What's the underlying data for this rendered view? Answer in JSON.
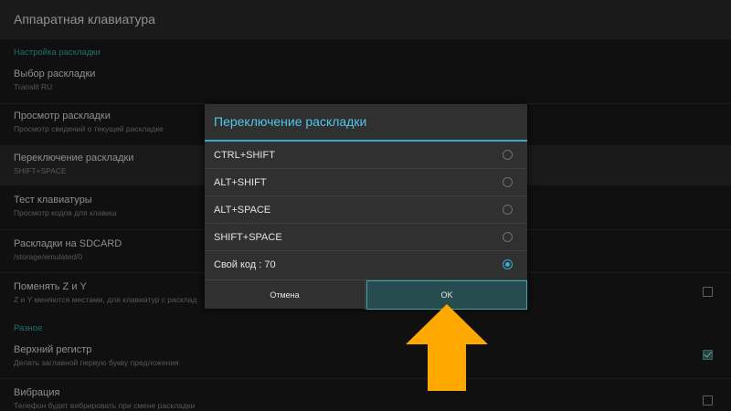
{
  "app": {
    "title": "Аппаратная клавиатура"
  },
  "sections": {
    "layout_settings": "Настройка раскладки",
    "misc": "Разное"
  },
  "prefs": [
    {
      "title": "Выбор раскладки",
      "summary": "Translit RU"
    },
    {
      "title": "Просмотр раскладки",
      "summary": "Просмотр сведений о текущей раскладке"
    },
    {
      "title": "Переключение раскладки",
      "summary": "SHIFT+SPACE"
    },
    {
      "title": "Тест клавиатуры",
      "summary": "Просмотр кодов для клавиш"
    },
    {
      "title": "Раскладки на SDCARD",
      "summary": "/storage/emulated/0"
    },
    {
      "title": "Поменять Z и Y",
      "summary": "Z и Y меняются местами, для клавиатур с расклад",
      "checked": false
    },
    {
      "title": "Верхний регистр",
      "summary": "Делать заглавной первую букву предложения",
      "checked": true
    },
    {
      "title": "Вибрация",
      "summary": "Телефон будет вибрировать при смене раскладки",
      "checked": false
    }
  ],
  "dialog": {
    "title": "Переключение раскладки",
    "options": [
      {
        "label": "CTRL+SHIFT",
        "selected": false
      },
      {
        "label": "ALT+SHIFT",
        "selected": false
      },
      {
        "label": "ALT+SPACE",
        "selected": false
      },
      {
        "label": "SHIFT+SPACE",
        "selected": false
      },
      {
        "label": "Свой код : 70",
        "selected": true
      }
    ],
    "cancel_label": "Отмена",
    "ok_label": "OK"
  },
  "colors": {
    "accent": "#38a9cf",
    "section": "#31b6a5",
    "arrow": "#ffa800"
  },
  "icons": {
    "annotation": "arrow-up-icon"
  }
}
